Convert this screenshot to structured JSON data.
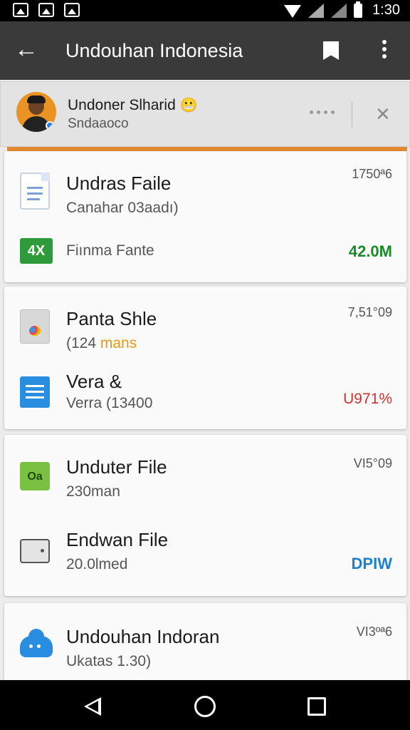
{
  "status_bar": {
    "time": "1:30",
    "icons": [
      "image-icon",
      "gallery-icon",
      "photo-icon",
      "wifi-icon",
      "signal-icon",
      "signal-icon",
      "battery-icon"
    ]
  },
  "app_bar": {
    "title": "Undouhan Indonesia",
    "back_icon": "arrow-left-icon",
    "bookmark_icon": "bookmark-icon",
    "more_icon": "more-vertical-icon"
  },
  "user": {
    "name": "Undoner Slharid",
    "emoji": "😬",
    "subtitle": "Sndaaoco",
    "close_glyph": "✕"
  },
  "cards": [
    {
      "items": [
        {
          "title": "Undras Faile",
          "subtitle": "Canahar 03aadı)",
          "meta": "1750ª6",
          "icon": "document-icon"
        },
        {
          "title": "",
          "subtitle": "Fiınma Fante",
          "meta": "42.0M",
          "icon": "excel-icon",
          "icon_text": "4X",
          "meta_color": "#1b8b2a"
        }
      ]
    },
    {
      "items": [
        {
          "title": "Panta Shle",
          "subtitle_prefix": "(124 ",
          "subtitle_highlight": "mans",
          "meta": "7,51°09",
          "icon": "image-file-icon",
          "highlight_color": "#e49a10"
        },
        {
          "title": "Vera &",
          "subtitle": "Verra (13400",
          "meta": "U971%",
          "icon": "blue-document-icon",
          "meta_color": "#c33333"
        }
      ]
    },
    {
      "items": [
        {
          "title": "Unduter File",
          "subtitle": "230man",
          "meta": "VI5°09",
          "icon": "green-folder-icon",
          "icon_text": "Oa"
        },
        {
          "title": "Endwan File",
          "subtitle": "20.0lmed",
          "meta": "DPIW",
          "icon": "drive-icon",
          "meta_color": "#1d7fd1"
        }
      ]
    },
    {
      "items": [
        {
          "title": "Undouhan Indoran",
          "subtitle": "Ukatas 1.30)",
          "meta": "VI3ºª6",
          "icon": "cloud-icon"
        }
      ]
    }
  ],
  "nav_bar": {
    "back_icon": "nav-back-icon",
    "home_icon": "nav-home-icon",
    "recents_icon": "nav-recents-icon"
  },
  "colors": {
    "app_bar": "#3a3a3a",
    "accent": "#e0892e",
    "status_bar": "#000000"
  }
}
